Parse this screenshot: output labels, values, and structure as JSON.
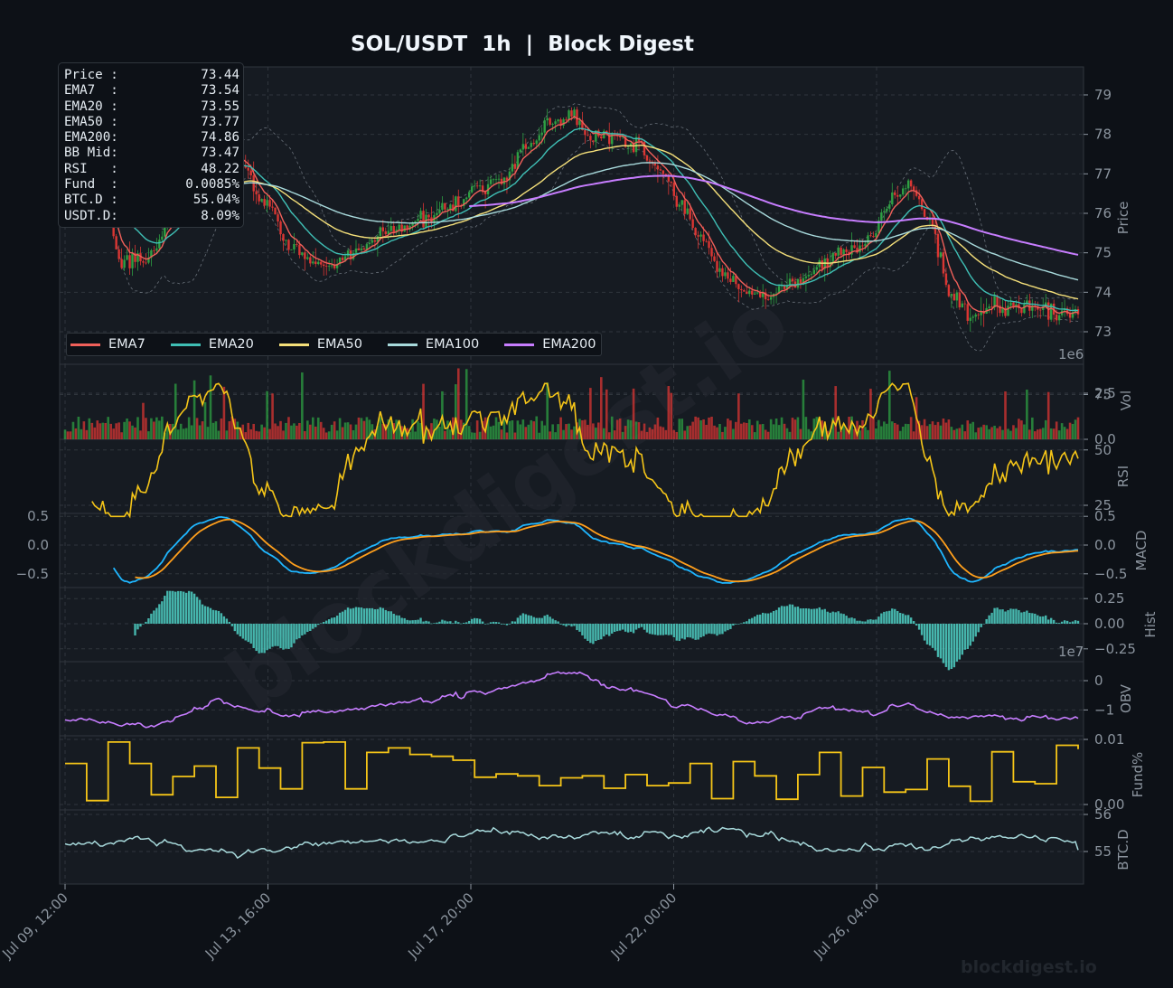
{
  "title": "SOL/USDT  1h  |  Block Digest",
  "watermark": "blockdigest.io",
  "footer_brand": "blockdigest.io",
  "info_box": [
    {
      "label": "Price :",
      "value": "73.44"
    },
    {
      "label": "EMA7  :",
      "value": "73.54"
    },
    {
      "label": "EMA20 :",
      "value": "73.55"
    },
    {
      "label": "EMA50 :",
      "value": "73.77"
    },
    {
      "label": "EMA200:",
      "value": "74.86"
    },
    {
      "label": "BB Mid:",
      "value": "73.47"
    },
    {
      "label": "RSI   :",
      "value": "48.22"
    },
    {
      "label": "Fund  :",
      "value": "0.0085%"
    },
    {
      "label": "BTC.D :",
      "value": "55.04%"
    },
    {
      "label": "USDT.D:",
      "value": "8.09%"
    }
  ],
  "legend": [
    {
      "label": "EMA7",
      "color": "#f0605a"
    },
    {
      "label": "EMA20",
      "color": "#3fbfb5"
    },
    {
      "label": "EMA50",
      "color": "#f5e07a"
    },
    {
      "label": "EMA100",
      "color": "#a8dadc"
    },
    {
      "label": "EMA200",
      "color": "#c77dff"
    }
  ],
  "sci_labels": {
    "vol": "1e6",
    "obv": "1e7"
  },
  "colors": {
    "background": "#0d1117",
    "panel": "#161b22",
    "grid": "#30363d",
    "up": "#2ea043",
    "down": "#da3633",
    "rsi": "#f5c518",
    "macd": "#1fb6ff",
    "signal": "#ff9f1c",
    "hist": "#4fd1c5",
    "obv": "#c77dff",
    "funding": "#f5c518",
    "btcd": "#a8dadc",
    "bb": "#8b949e"
  },
  "chart_data": {
    "type": "line",
    "symbol": "SOL/USDT",
    "interval": "1h",
    "x_ticks": [
      "Jul 09, 12:00",
      "Jul 13, 16:00",
      "Jul 17, 20:00",
      "Jul 22, 00:00",
      "Jul 26, 04:00"
    ],
    "price_key_points": [
      [
        0,
        77.3
      ],
      [
        6,
        77.4
      ],
      [
        12,
        76.4
      ],
      [
        22,
        74.8
      ],
      [
        32,
        74.9
      ],
      [
        40,
        76.1
      ],
      [
        48,
        77.0
      ],
      [
        58,
        77.7
      ],
      [
        66,
        77.2
      ],
      [
        74,
        76.3
      ],
      [
        84,
        75.2
      ],
      [
        92,
        74.8
      ],
      [
        100,
        74.7
      ],
      [
        110,
        75.1
      ],
      [
        120,
        75.5
      ],
      [
        132,
        75.8
      ],
      [
        144,
        76.2
      ],
      [
        156,
        76.7
      ],
      [
        164,
        77.0
      ],
      [
        172,
        77.7
      ],
      [
        180,
        78.3
      ],
      [
        188,
        78.4
      ],
      [
        196,
        78.0
      ],
      [
        204,
        77.9
      ],
      [
        212,
        77.8
      ],
      [
        220,
        77.1
      ],
      [
        228,
        76.3
      ],
      [
        236,
        75.4
      ],
      [
        246,
        74.4
      ],
      [
        256,
        73.9
      ],
      [
        264,
        74.0
      ],
      [
        272,
        74.2
      ],
      [
        282,
        74.8
      ],
      [
        292,
        75.1
      ],
      [
        300,
        75.5
      ],
      [
        308,
        76.4
      ],
      [
        314,
        76.8
      ],
      [
        320,
        75.8
      ],
      [
        330,
        73.9
      ],
      [
        336,
        73.4
      ],
      [
        344,
        73.7
      ],
      [
        352,
        73.6
      ],
      [
        362,
        73.6
      ],
      [
        370,
        73.5
      ],
      [
        376,
        73.44
      ]
    ],
    "panels": [
      {
        "name": "Price",
        "ylabel": "Price",
        "ticks": [
          73,
          74,
          75,
          76,
          77,
          78,
          79
        ]
      },
      {
        "name": "Vol",
        "ylabel": "Vol",
        "scale": "1e6",
        "ticks": [
          0.0,
          2.5
        ]
      },
      {
        "name": "RSI",
        "ylabel": "RSI",
        "ticks": [
          25,
          50,
          75
        ]
      },
      {
        "name": "MACD",
        "ylabel": "MACD",
        "ticks": [
          -0.5,
          0.0,
          0.5
        ]
      },
      {
        "name": "Hist",
        "ylabel": "Hist",
        "ticks": [
          -0.25,
          0.0,
          0.25
        ]
      },
      {
        "name": "OBV",
        "ylabel": "OBV",
        "scale": "1e7",
        "ticks": [
          -1,
          0
        ]
      },
      {
        "name": "Fund%",
        "ylabel": "Fund%",
        "ticks": [
          0.0,
          0.01
        ]
      },
      {
        "name": "BTC.D",
        "ylabel": "BTC.D",
        "ticks": [
          55,
          56
        ]
      }
    ],
    "series": [
      {
        "name": "EMA7",
        "last": 73.54
      },
      {
        "name": "EMA20",
        "last": 73.55
      },
      {
        "name": "EMA50",
        "last": 73.77
      },
      {
        "name": "EMA100"
      },
      {
        "name": "EMA200",
        "last": 74.86
      }
    ],
    "last_values": {
      "price": 73.44,
      "bb_mid": 73.47,
      "rsi": 48.22,
      "funding_pct": 0.0085,
      "btc_d_pct": 55.04,
      "usdt_d_pct": 8.09
    },
    "grid": true,
    "legend_position": "lower-left"
  }
}
